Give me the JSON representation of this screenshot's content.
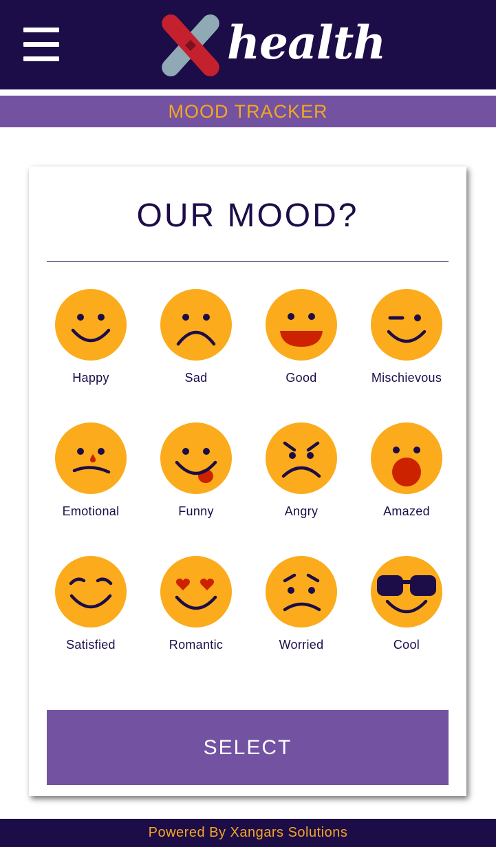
{
  "header": {
    "menu_icon": "hamburger-menu-icon",
    "logo_text": "health",
    "logo_icon": "x-logo-icon",
    "colors": {
      "background": "#1c0c48",
      "logo_red": "#c4202e",
      "logo_gray": "#8fa9b5"
    }
  },
  "subheader": {
    "title": "MOOD TRACKER",
    "background": "#7352a2",
    "text_color": "#f4a623"
  },
  "card": {
    "title": "OUR MOOD?",
    "moods": [
      {
        "label": "Happy",
        "icon": "happy-face-icon"
      },
      {
        "label": "Sad",
        "icon": "sad-face-icon"
      },
      {
        "label": "Good",
        "icon": "grin-face-icon"
      },
      {
        "label": "Mischievous",
        "icon": "wink-face-icon"
      },
      {
        "label": "Emotional",
        "icon": "tear-face-icon"
      },
      {
        "label": "Funny",
        "icon": "tongue-face-icon"
      },
      {
        "label": "Angry",
        "icon": "angry-face-icon"
      },
      {
        "label": "Amazed",
        "icon": "surprised-face-icon"
      },
      {
        "label": "Satisfied",
        "icon": "content-face-icon"
      },
      {
        "label": "Romantic",
        "icon": "heart-eyes-face-icon"
      },
      {
        "label": "Worried",
        "icon": "worried-face-icon"
      },
      {
        "label": "Cool",
        "icon": "sunglasses-face-icon"
      }
    ],
    "select_label": "SELECT"
  },
  "footer": {
    "text": "Powered By Xangars Solutions"
  },
  "colors": {
    "emoji_yellow": "#fbab1b",
    "emoji_ink": "#1c0c48",
    "accent_red": "#cc2200"
  }
}
